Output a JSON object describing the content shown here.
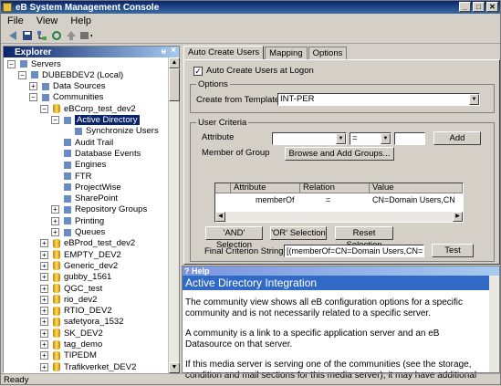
{
  "window": {
    "title": "eB System Management Console",
    "min": "_",
    "max": "□",
    "close": "✕"
  },
  "menu": [
    "File",
    "View",
    "Help"
  ],
  "toolbar": {
    "icons": [
      "nav-back-icon",
      "save-icon",
      "tree-icon",
      "refresh-icon",
      "up-icon",
      "view-icon"
    ]
  },
  "explorer": {
    "title": "Explorer",
    "pin": "ᵾ",
    "close": "×",
    "nodes": [
      {
        "label": "Servers",
        "level": 0,
        "exp": "−"
      },
      {
        "label": "DUBEBDEV2 (Local)",
        "level": 1,
        "exp": "−"
      },
      {
        "label": "Data Sources",
        "level": 2,
        "exp": "+"
      },
      {
        "label": "Communities",
        "level": 2,
        "exp": "−"
      },
      {
        "label": "eBCorp_test_dev2",
        "level": 3,
        "exp": "−"
      },
      {
        "label": "Active Directory",
        "level": 4,
        "exp": "−",
        "selected": true
      },
      {
        "label": "Synchronize Users",
        "level": 5,
        "exp": ""
      },
      {
        "label": "Audit Trail",
        "level": 4,
        "exp": ""
      },
      {
        "label": "Database Events",
        "level": 4,
        "exp": ""
      },
      {
        "label": "Engines",
        "level": 4,
        "exp": ""
      },
      {
        "label": "FTR",
        "level": 4,
        "exp": ""
      },
      {
        "label": "ProjectWise",
        "level": 4,
        "exp": ""
      },
      {
        "label": "SharePoint",
        "level": 4,
        "exp": ""
      },
      {
        "label": "Repository Groups",
        "level": 4,
        "exp": "+"
      },
      {
        "label": "Printing",
        "level": 4,
        "exp": "+"
      },
      {
        "label": "Queues",
        "level": 4,
        "exp": "+"
      },
      {
        "label": "eBProd_test_dev2",
        "level": 3,
        "exp": "+"
      },
      {
        "label": "EMPTY_DEV2",
        "level": 3,
        "exp": "+"
      },
      {
        "label": "Generic_dev2",
        "level": 3,
        "exp": "+"
      },
      {
        "label": "gubby_1561",
        "level": 3,
        "exp": "+"
      },
      {
        "label": "QGC_test",
        "level": 3,
        "exp": "+"
      },
      {
        "label": "rio_dev2",
        "level": 3,
        "exp": "+"
      },
      {
        "label": "RTIO_DEV2",
        "level": 3,
        "exp": "+"
      },
      {
        "label": "safetyora_1532",
        "level": 3,
        "exp": "+"
      },
      {
        "label": "SK_DEV2",
        "level": 3,
        "exp": "+"
      },
      {
        "label": "tag_demo",
        "level": 3,
        "exp": "+"
      },
      {
        "label": "TIPEDM",
        "level": 3,
        "exp": "+"
      },
      {
        "label": "Trafikverket_DEV2",
        "level": 3,
        "exp": "+"
      }
    ]
  },
  "tabs": [
    "Auto Create Users",
    "Mapping",
    "Options"
  ],
  "auto_create": {
    "checkbox_label": "Auto Create Users at Logon",
    "checked_mark": "✓",
    "options_group": "Options",
    "template_label": "Create from Template:",
    "template_value": "INT-PER",
    "criteria_group": "User Criteria",
    "attribute_label": "Attribute",
    "member_label": "Member of Group",
    "operator_value": "=",
    "add_button": "Add",
    "browse_button": "Browse and Add Groups...",
    "grid": {
      "headers": [
        "Attribute",
        "Relation",
        "Value"
      ],
      "row": {
        "attribute": "memberOf",
        "relation": "=",
        "value": "CN=Domain Users,CN"
      }
    },
    "and_button": "'AND' Selection",
    "or_button": "'OR' Selection",
    "reset_button": "Reset Selection",
    "final_label": "Final Criterion String:",
    "final_value": "[(memberOf=CN=Domain Users,CN=Users,DC=",
    "test_button": "Test"
  },
  "help": {
    "header": "Help",
    "title": "Active Directory Integration",
    "paragraphs": [
      "The community view shows all eB configuration options for a specific community and is not necessarily related to a specific server.",
      "A community is a link to a specific application server and an eB Datasource on that server.",
      "If this media server is serving one of the communities (see the storage, condition and mail sections for this media server), it may have additional"
    ]
  },
  "status": "Ready"
}
